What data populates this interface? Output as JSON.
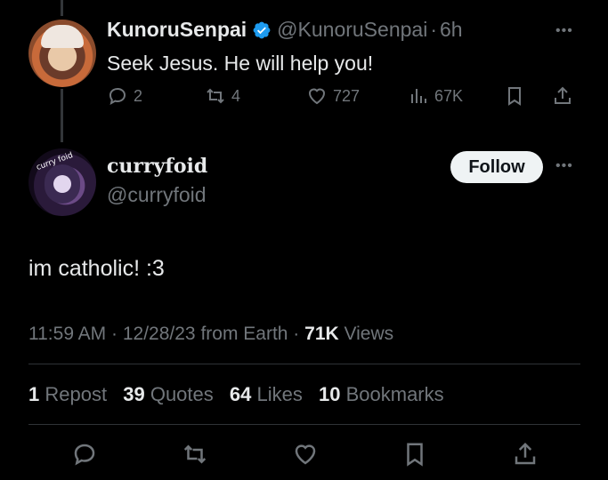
{
  "tweet1": {
    "name": "KunoruSenpai",
    "handle": "@KunoruSenpai",
    "separator": "·",
    "time": "6h",
    "text": "Seek Jesus. He will help you!",
    "actions": {
      "replies": "2",
      "reposts": "4",
      "likes": "727",
      "views": "67K"
    }
  },
  "tweet2": {
    "name": "curryfoid",
    "handle": "@curryfoid",
    "avatar_tag": "curry foid",
    "follow_label": "Follow",
    "text": "im catholic! :3",
    "meta": {
      "time": "11:59 AM",
      "date": "12/28/23",
      "source": "from Earth",
      "views_count": "71K",
      "views_label": "Views"
    },
    "stats": {
      "reposts_num": "1",
      "reposts_label": "Repost",
      "quotes_num": "39",
      "quotes_label": "Quotes",
      "likes_num": "64",
      "likes_label": "Likes",
      "bookmarks_num": "10",
      "bookmarks_label": "Bookmarks"
    }
  },
  "colors": {
    "background": "#000000",
    "text": "#e7e9ea",
    "secondary": "#71767b",
    "verified": "#1d9bf0",
    "divider": "#2f3336"
  },
  "icons": {
    "reply": "reply-icon",
    "repost": "repost-icon",
    "like": "heart-icon",
    "views": "views-icon",
    "bookmark": "bookmark-icon",
    "share": "share-icon",
    "more": "more-icon",
    "verified": "verified-badge-icon"
  }
}
